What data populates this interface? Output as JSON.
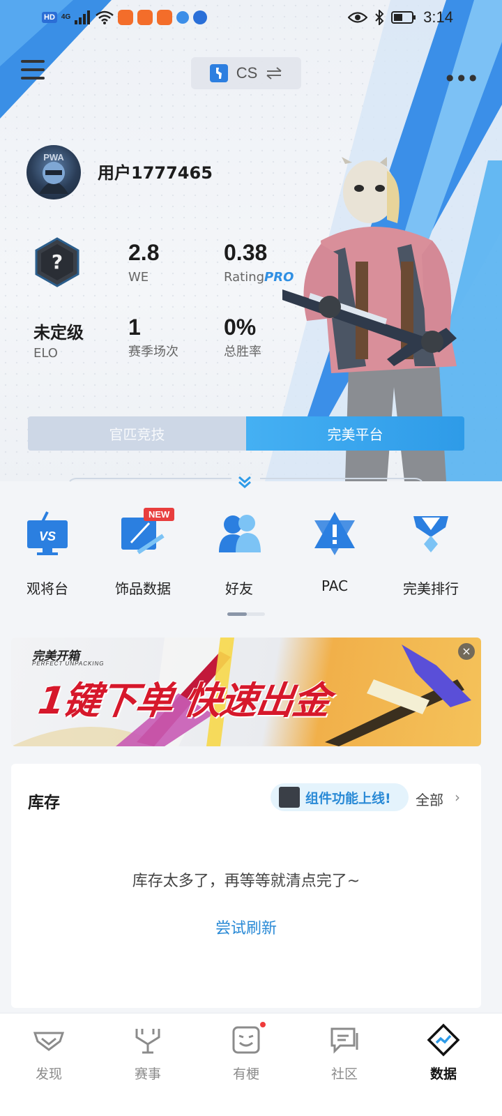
{
  "status_bar": {
    "hd": "HD",
    "network": "4G",
    "time": "3:14"
  },
  "header": {
    "game_name": "CS"
  },
  "profile": {
    "username": "用户1777465",
    "stats": {
      "we": {
        "value": "2.8",
        "label": "WE"
      },
      "rating": {
        "value": "0.38",
        "label": "Rating",
        "label_suffix": "PRO"
      },
      "elo": {
        "value": "未定级",
        "label": "ELO"
      },
      "season_matches": {
        "value": "1",
        "label": "赛季场次"
      },
      "win_rate": {
        "value": "0%",
        "label": "总胜率"
      }
    }
  },
  "mode_tabs": [
    {
      "label": "官匹竞技",
      "active": false
    },
    {
      "label": "完美平台",
      "active": true
    }
  ],
  "shortcuts": [
    {
      "label": "观将台",
      "icon": "vs-monitor-icon"
    },
    {
      "label": "饰品数据",
      "icon": "skin-data-icon",
      "badge": "NEW"
    },
    {
      "label": "好友",
      "icon": "friends-icon"
    },
    {
      "label": "PAC",
      "icon": "pac-shield-icon"
    },
    {
      "label": "完美排行",
      "icon": "ranking-medal-icon"
    }
  ],
  "banner": {
    "brand": "完美开箱",
    "brand_sub": "PERFECT UNPACKING",
    "slogan": "1键下单 快速出金",
    "close_symbol": "×"
  },
  "inventory": {
    "title": "库存",
    "widget_notice": "组件功能上线!",
    "view_all": "全部",
    "chevron": "›",
    "empty_message": "库存太多了，再等等就清点完了~",
    "refresh": "尝试刷新"
  },
  "bottom_nav": [
    {
      "label": "发现",
      "icon": "discover-icon",
      "active": false
    },
    {
      "label": "赛事",
      "icon": "tournament-icon",
      "active": false
    },
    {
      "label": "有梗",
      "icon": "meme-face-icon",
      "active": false,
      "dot": true
    },
    {
      "label": "社区",
      "icon": "community-icon",
      "active": false
    },
    {
      "label": "数据",
      "icon": "data-icon",
      "active": true
    }
  ],
  "colors": {
    "accent_blue": "#2e9be8",
    "link_blue": "#2a8ad6",
    "badge_red": "#e83e3e"
  }
}
